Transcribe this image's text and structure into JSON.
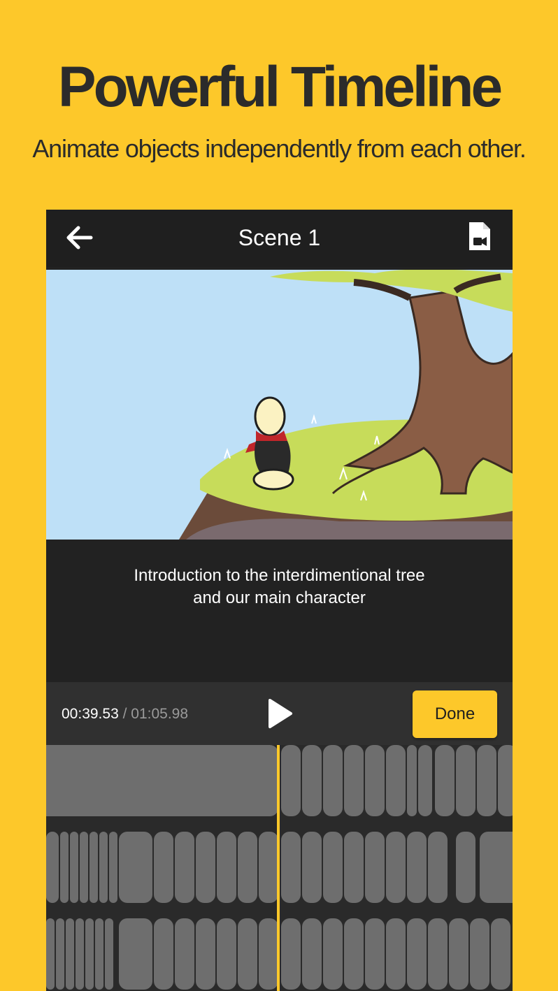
{
  "promo": {
    "headline": "Powerful Timeline",
    "subline": "Animate objects independently from each other."
  },
  "appbar": {
    "title": "Scene 1",
    "back_icon": "arrow-left-icon",
    "export_icon": "video-file-icon"
  },
  "scene": {
    "caption_line1": "Introduction to the interdimentional tree",
    "caption_line2": "and our main character"
  },
  "playback": {
    "current_time": "00:39.53",
    "separator": " / ",
    "total_time": "01:05.98",
    "play_icon": "play-icon",
    "done_label": "Done"
  },
  "colors": {
    "background": "#FDC82A",
    "accent": "#FDC82A",
    "panel": "#222222",
    "appbar": "#1F1F1F",
    "frame_cell": "#6E6E6E"
  }
}
